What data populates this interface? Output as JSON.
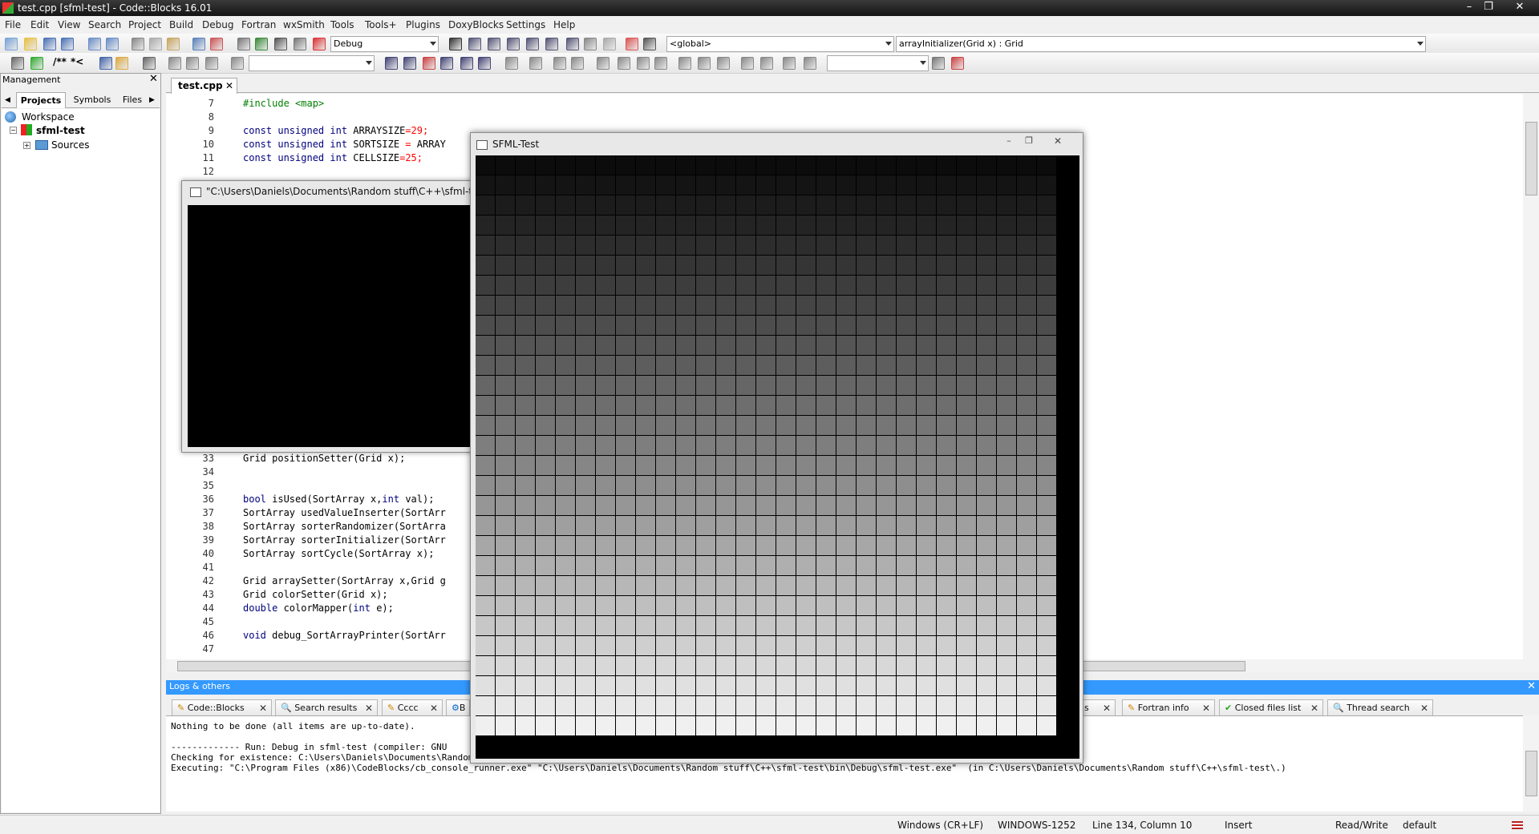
{
  "window_title": "test.cpp [sfml-test] - Code::Blocks 16.01",
  "window_controls": {
    "minimize": "–",
    "maximize": "❐",
    "close": "✕"
  },
  "menu": [
    "File",
    "Edit",
    "View",
    "Search",
    "Project",
    "Build",
    "Debug",
    "Fortran",
    "wxSmith",
    "Tools",
    "Tools+",
    "Plugins",
    "DoxyBlocks",
    "Settings",
    "Help"
  ],
  "toolbar": {
    "build_target": "Debug",
    "scope": "<global>",
    "function": "arrayInitializer(Grid x) : Grid",
    "doxy_comment_labels": [
      "/**",
      "*<"
    ]
  },
  "management": {
    "title": "Management",
    "tabs": [
      "Projects",
      "Symbols",
      "Files"
    ],
    "tree": {
      "workspace": "Workspace",
      "project": "sfml-test",
      "folder": "Sources"
    }
  },
  "editor": {
    "tab": "test.cpp",
    "lines_top": [
      {
        "n": "7",
        "parts": [
          {
            "t": "#include <map>",
            "c": "pp"
          }
        ]
      },
      {
        "n": "8",
        "parts": []
      },
      {
        "n": "9",
        "parts": [
          {
            "t": "const unsigned int",
            "c": "kw"
          },
          {
            "t": " ARRAYSIZE"
          },
          {
            "t": "=",
            "c": "op"
          },
          {
            "t": "29",
            "c": "num"
          },
          {
            "t": ";",
            "c": "op"
          }
        ]
      },
      {
        "n": "10",
        "parts": [
          {
            "t": "const unsigned int",
            "c": "kw"
          },
          {
            "t": " SORTSIZE "
          },
          {
            "t": "=",
            "c": "op"
          },
          {
            "t": " ARRAY"
          }
        ]
      },
      {
        "n": "11",
        "parts": [
          {
            "t": "const unsigned int",
            "c": "kw"
          },
          {
            "t": " CELLSIZE"
          },
          {
            "t": "=",
            "c": "op"
          },
          {
            "t": "25",
            "c": "num"
          },
          {
            "t": ";",
            "c": "op"
          }
        ]
      },
      {
        "n": "12",
        "parts": []
      }
    ],
    "lines_bottom": [
      {
        "n": "33",
        "parts": [
          {
            "t": "Grid positionSetter(Grid x);"
          }
        ]
      },
      {
        "n": "34",
        "parts": []
      },
      {
        "n": "35",
        "parts": []
      },
      {
        "n": "36",
        "parts": [
          {
            "t": "bool",
            "c": "kw"
          },
          {
            "t": " isUsed(SortArray x,"
          },
          {
            "t": "int",
            "c": "kw"
          },
          {
            "t": " val);"
          }
        ]
      },
      {
        "n": "37",
        "parts": [
          {
            "t": "SortArray usedValueInserter(SortArr"
          }
        ]
      },
      {
        "n": "38",
        "parts": [
          {
            "t": "SortArray sorterRandomizer(SortArra"
          }
        ]
      },
      {
        "n": "39",
        "parts": [
          {
            "t": "SortArray sorterInitializer(SortArr"
          }
        ]
      },
      {
        "n": "40",
        "parts": [
          {
            "t": "SortArray sortCycle(SortArray x);"
          }
        ]
      },
      {
        "n": "41",
        "parts": []
      },
      {
        "n": "42",
        "parts": [
          {
            "t": "Grid arraySetter(SortArray x,Grid g"
          }
        ]
      },
      {
        "n": "43",
        "parts": [
          {
            "t": "Grid colorSetter(Grid x);"
          }
        ]
      },
      {
        "n": "44",
        "parts": [
          {
            "t": "double",
            "c": "kw"
          },
          {
            "t": " colorMapper("
          },
          {
            "t": "int",
            "c": "kw"
          },
          {
            "t": " e);"
          }
        ]
      },
      {
        "n": "45",
        "parts": []
      },
      {
        "n": "46",
        "parts": [
          {
            "t": "void",
            "c": "kw"
          },
          {
            "t": " debug_SortArrayPrinter(SortArr"
          }
        ]
      },
      {
        "n": "47",
        "parts": []
      }
    ]
  },
  "console_window": {
    "title": "\"C:\\Users\\Daniels\\Documents\\Random stuff\\C++\\sfml-test\\bi"
  },
  "sfml_window": {
    "title": "SFML-Test",
    "grid_rows": 29,
    "grid_cols": 29
  },
  "logs": {
    "title": "Logs & others",
    "tabs": [
      "Code::Blocks",
      "Search results",
      "Cccc",
      "B",
      "s",
      "Fortran info",
      "Closed files list",
      "Thread search"
    ],
    "lines": [
      "Nothing to be done (all items are up-to-date).",
      "",
      "------------- Run: Debug in sfml-test (compiler: GNU",
      "Checking for existence: C:\\Users\\Daniels\\Documents\\Random stuff\\C++\\sfml-test\\bin\\Debug\\sfml-test.exe",
      "Executing: \"C:\\Program Files (x86)\\CodeBlocks/cb_console_runner.exe\" \"C:\\Users\\Daniels\\Documents\\Random stuff\\C++\\sfml-test\\bin\\Debug\\sfml-test.exe\"  (in C:\\Users\\Daniels\\Documents\\Random stuff\\C++\\sfml-test\\.)"
    ]
  },
  "statusbar": {
    "eol": "Windows (CR+LF)",
    "encoding": "WINDOWS-1252",
    "position": "Line 134, Column 10",
    "mode": "Insert",
    "access": "Read/Write",
    "profile": "default"
  },
  "colors": {
    "accent": "#3399ff",
    "logs_header": "#3399ff"
  }
}
